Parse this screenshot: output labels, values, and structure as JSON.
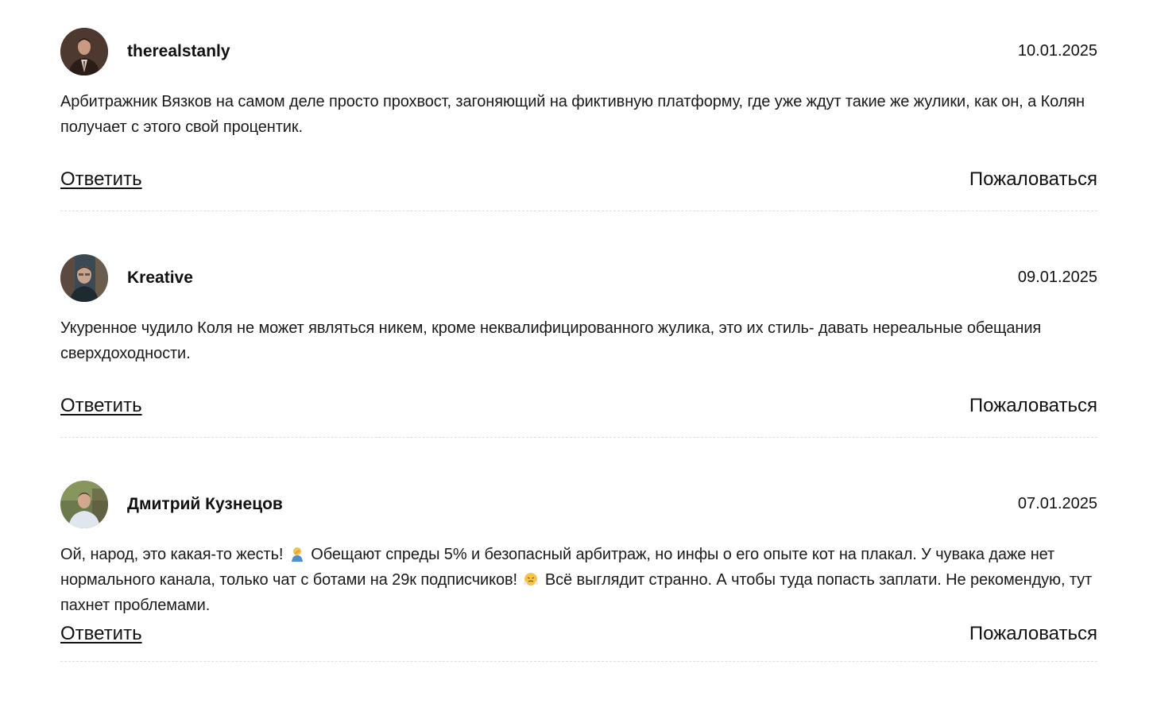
{
  "actions": {
    "reply_label": "Ответить",
    "complain_label": "Пожаловаться"
  },
  "comments": [
    {
      "author": "therealstanly",
      "date": "10.01.2025",
      "text": "Арбитражник Вязков на самом деле просто прохвост, загоняющий на фиктивную платформу, где уже ждут такие же жулики, как он, а Колян получает с этого свой процентик."
    },
    {
      "author": "Kreative",
      "date": "09.01.2025",
      "text": "Укуренное чудило Коля не может являться никем, кроме неквалифицированного жулика, это их стиль- давать нереальные обещания сверхдоходности."
    },
    {
      "author": "Дмитрий Кузнецов",
      "date": "07.01.2025",
      "text_part1": "Ой, народ, это какая-то жесть!",
      "text_part2": "Обещают спреды 5% и безопасный арбитраж, но инфы о его опыте кот на плакал. У чувака даже нет нормального канала, только чат с ботами на 29к подписчиков!",
      "text_part3": "Всё выглядит странно. А чтобы туда попасть заплати. Не рекомендую, тут пахнет проблемами.",
      "emoji_1": "person-facepalming-emoji",
      "emoji_2": "face-with-steam-emoji"
    }
  ]
}
